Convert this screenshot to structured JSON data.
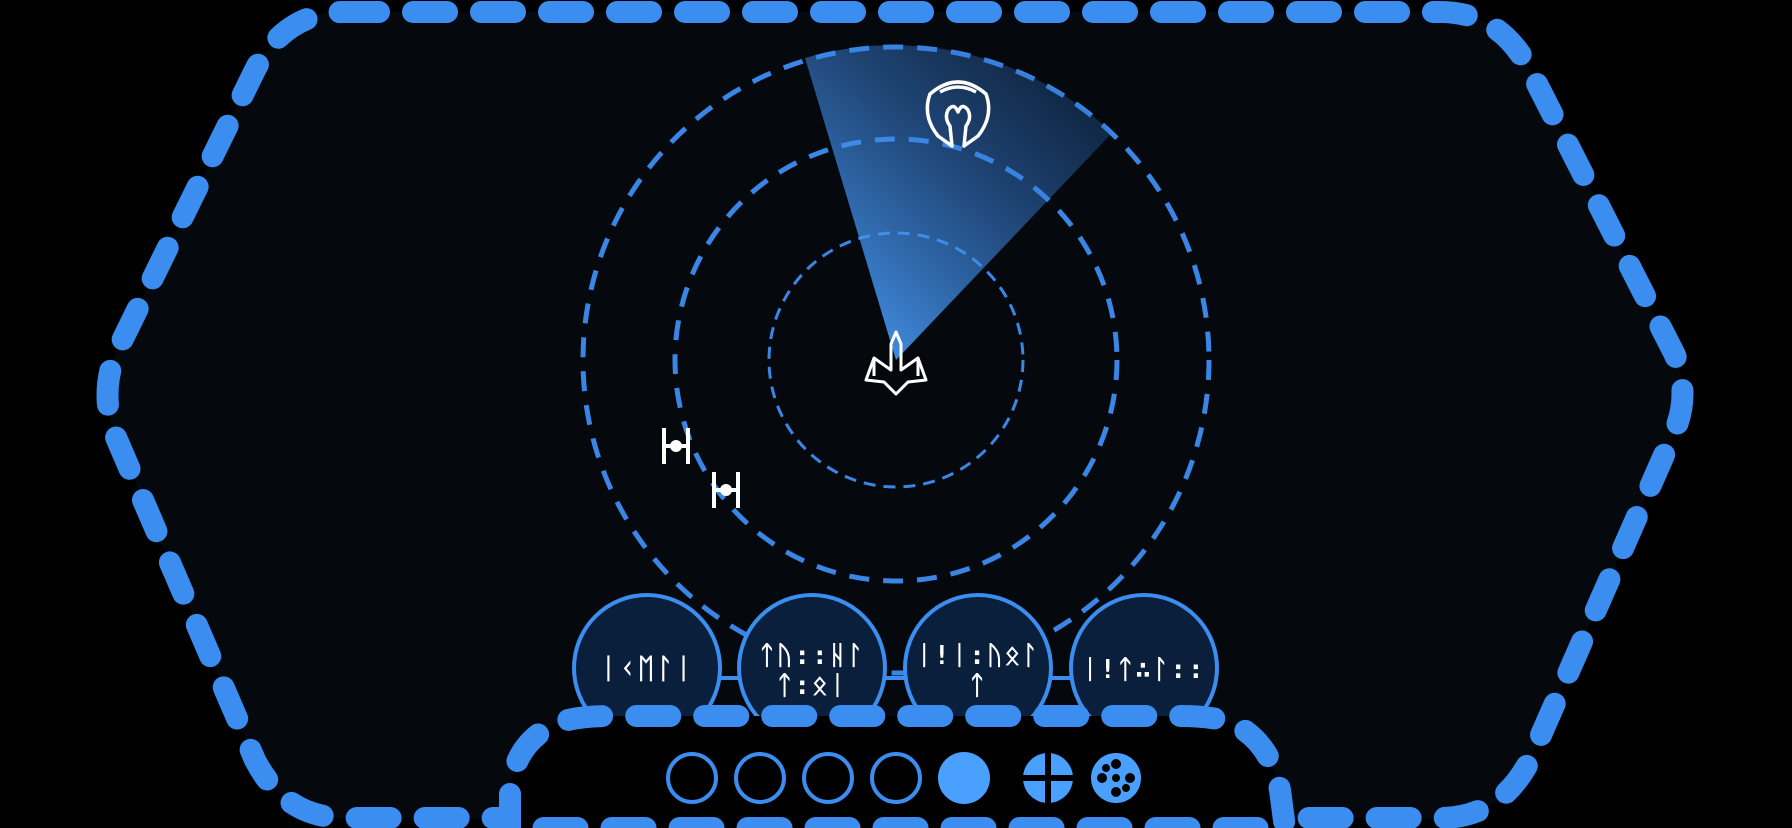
{
  "colors": {
    "background": "#000000",
    "panel": "#05080d",
    "frame_dash": "#3b8ef0",
    "ring_dash": "#3a86e6",
    "button_fill": "#0a1f3b",
    "button_stroke": "#3b8ef0",
    "icon": "#ffffff",
    "sweep": "#4aa0ff",
    "dot_active": "#4aa0ff"
  },
  "radar": {
    "player_ship_icon": "starfighter-icon",
    "enemy_ships": [
      {
        "id": "enemy-1",
        "icon": "tie-fighter-icon"
      },
      {
        "id": "enemy-2",
        "icon": "tie-fighter-icon"
      }
    ],
    "target_icon": "mask-emblem-icon"
  },
  "action_buttons": [
    {
      "id": "action-1",
      "lines": [
        "ᛁᚲᛖᛚᛁ"
      ]
    },
    {
      "id": "action-2",
      "lines": [
        "ᛏᚢ::ᚺᛚ",
        "ᛏ:ᛟᛁ"
      ]
    },
    {
      "id": "action-3",
      "lines": [
        "ᛁ!ᛁ:ᚢᛟᛚ",
        "ᛏ"
      ]
    },
    {
      "id": "action-4",
      "lines": [
        "ᛁ!ᛏ∴ᛚ::"
      ]
    }
  ],
  "page_indicator": {
    "total_pages": 5,
    "current_page": 5
  },
  "bottom_tools": [
    {
      "id": "crosshair-button",
      "icon": "crosshair-icon"
    },
    {
      "id": "reel-button",
      "icon": "film-reel-icon"
    }
  ]
}
